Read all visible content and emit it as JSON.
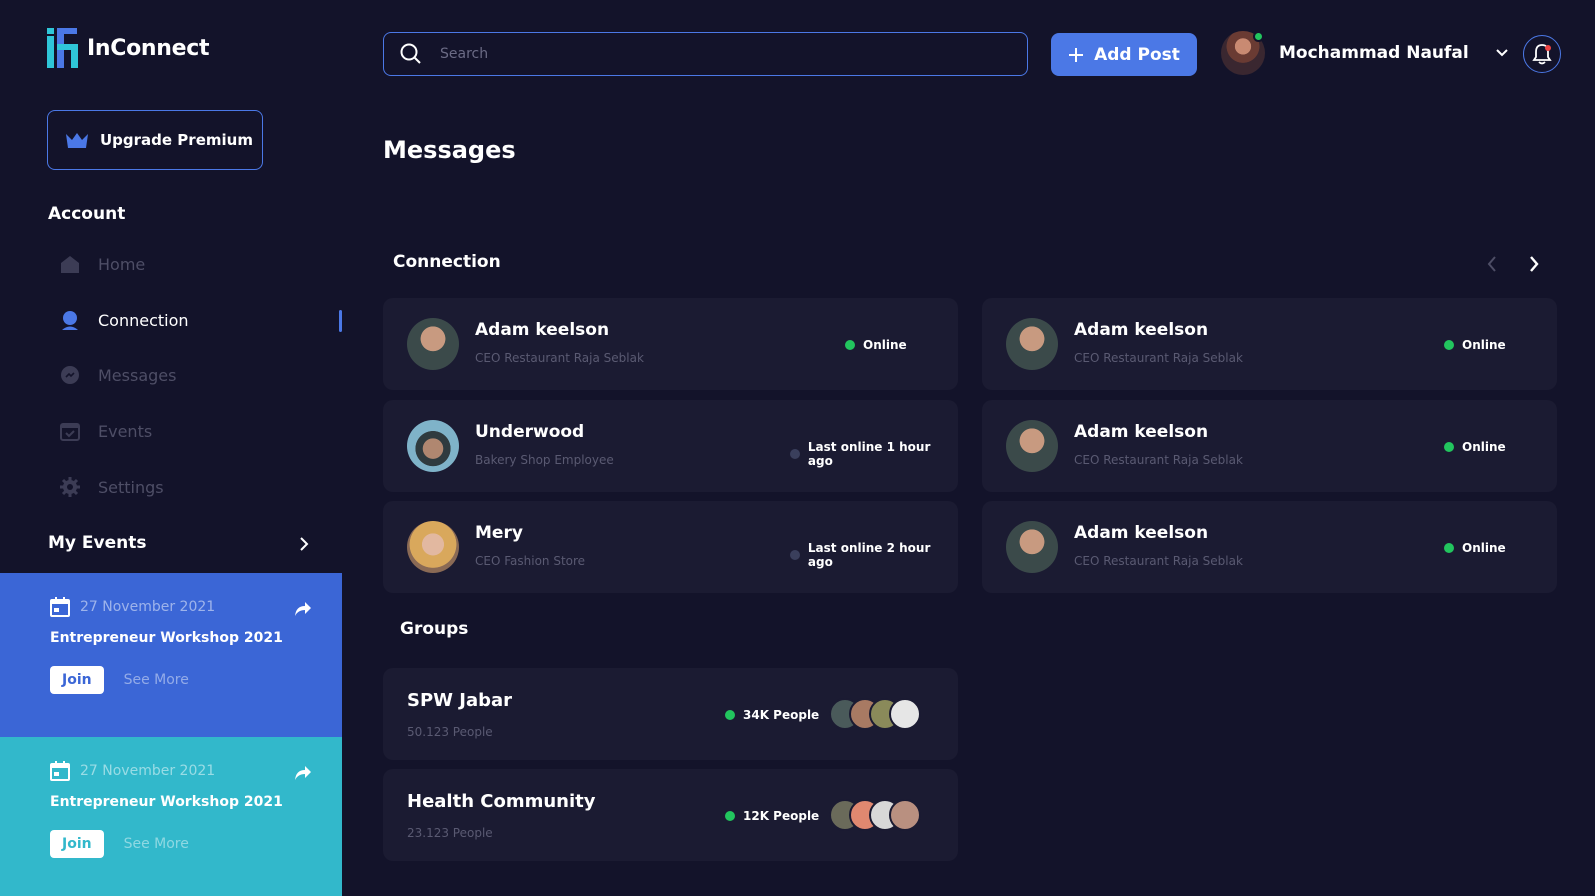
{
  "app": {
    "name": "InConnect"
  },
  "sidebar": {
    "upgrade_label": "Upgrade Premium",
    "account_title": "Account",
    "items": [
      {
        "label": "Home",
        "icon": "home-icon",
        "active": false
      },
      {
        "label": "Connection",
        "icon": "user-icon",
        "active": true
      },
      {
        "label": "Messages",
        "icon": "chat-icon",
        "active": false
      },
      {
        "label": "Events",
        "icon": "calendar-icon",
        "active": false
      },
      {
        "label": "Settings",
        "icon": "gear-icon",
        "active": false
      }
    ],
    "my_events_title": "My Events",
    "events": [
      {
        "date": "27 November 2021",
        "title": "Entrepreneur Workshop 2021",
        "join_label": "Join",
        "more_label": "See More",
        "color": "#3b66d6"
      },
      {
        "date": "27 November 2021",
        "title": "Entrepreneur Workshop 2021",
        "join_label": "Join",
        "more_label": "See More",
        "color": "#32b8cb"
      }
    ]
  },
  "header": {
    "search_placeholder": "Search",
    "add_post_label": "Add Post",
    "user_name": "Mochammad Naufal"
  },
  "main": {
    "title": "Messages",
    "connection_title": "Connection",
    "connections": [
      {
        "name": "Adam keelson",
        "role": "CEO Restaurant Raja Seblak",
        "status": "Online",
        "online": true
      },
      {
        "name": "Adam keelson",
        "role": "CEO Restaurant Raja Seblak",
        "status": "Online",
        "online": true
      },
      {
        "name": "Underwood",
        "role": "Bakery Shop Employee",
        "status": "Last online 1 hour ago",
        "online": false
      },
      {
        "name": "Adam keelson",
        "role": "CEO Restaurant Raja Seblak",
        "status": "Online",
        "online": true
      },
      {
        "name": "Mery",
        "role": "CEO Fashion Store",
        "status": "Last online 2 hour ago",
        "online": false
      },
      {
        "name": "Adam keelson",
        "role": "CEO Restaurant Raja Seblak",
        "status": "Online",
        "online": true
      }
    ],
    "groups_title": "Groups",
    "groups": [
      {
        "name": "SPW Jabar",
        "count": "50.123 People",
        "people": "34K People"
      },
      {
        "name": "Health Community",
        "count": "23.123 People",
        "people": "12K People"
      }
    ]
  },
  "colors": {
    "accent": "#4b78e6",
    "online": "#22c55e",
    "offline": "#3a3f5c",
    "card": "#1b1b32",
    "background": "#13132a"
  }
}
